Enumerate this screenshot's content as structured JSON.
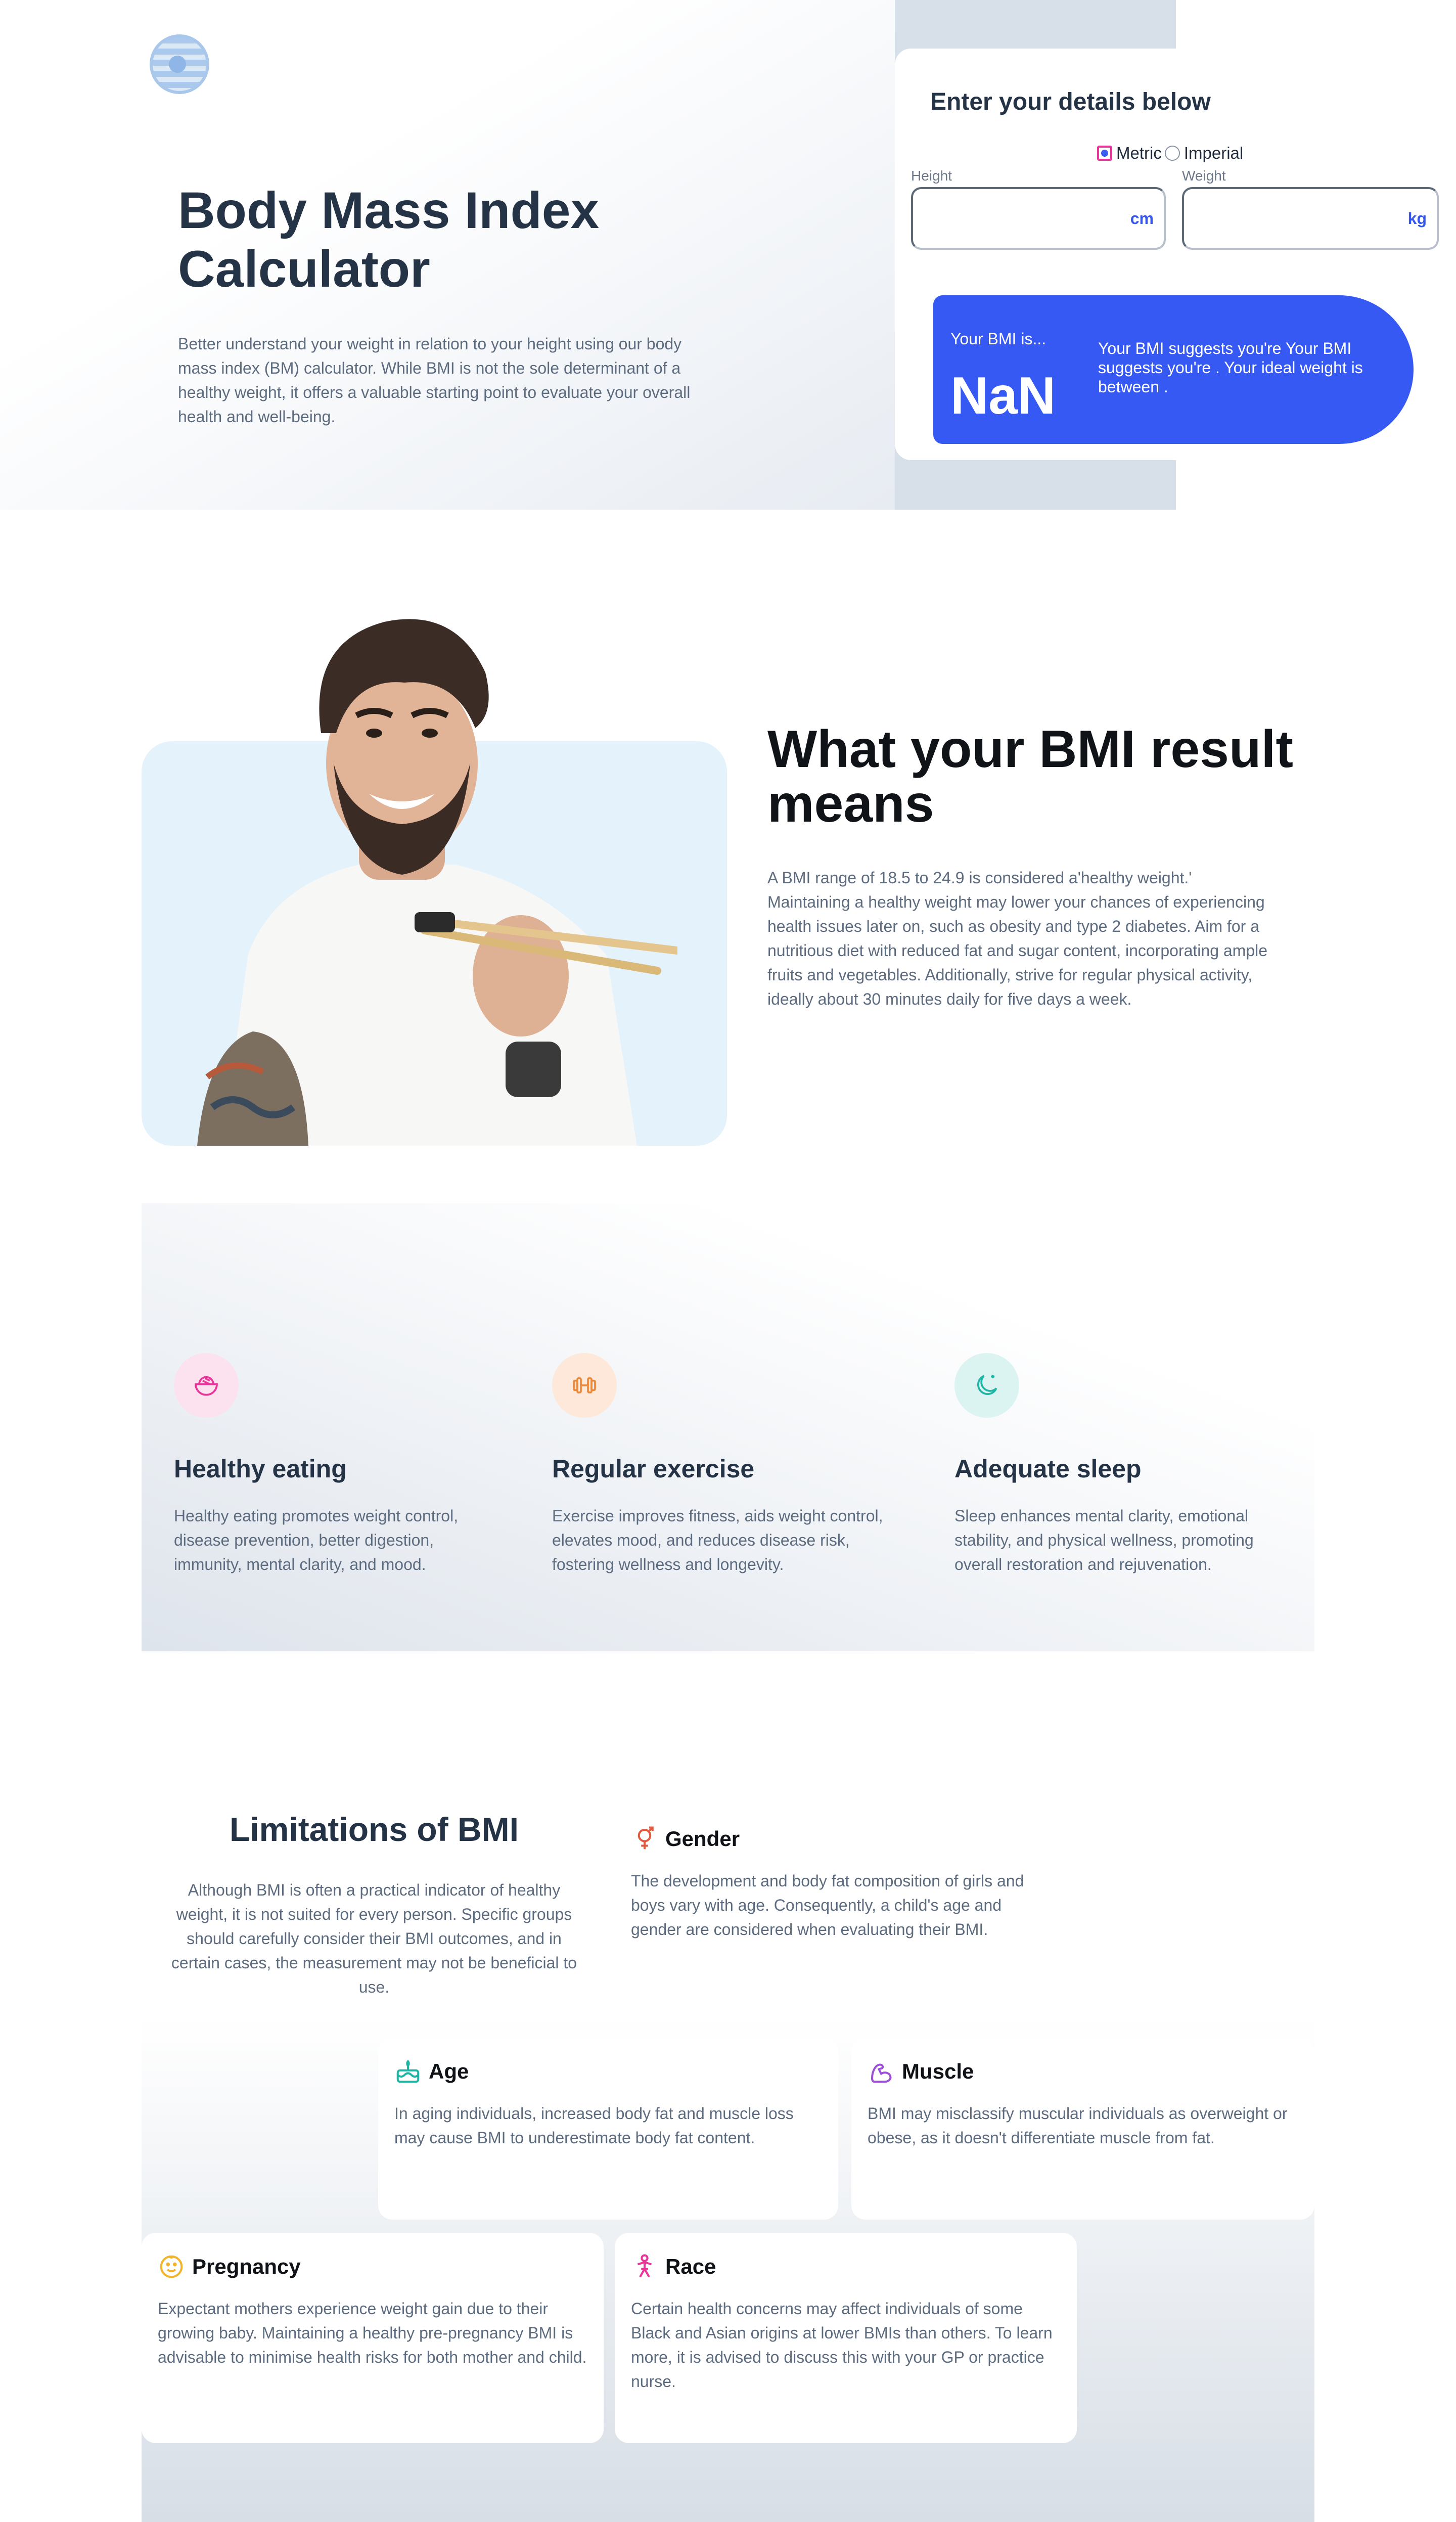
{
  "hero": {
    "title": "Body Mass Index Calculator",
    "description": "Better understand your weight in relation to your height using our body mass index (BM) calculator. While BMI is not the sole determinant of a healthy weight, it offers a valuable starting point to evaluate your overall health and well-being."
  },
  "calculator": {
    "title": "Enter your details below",
    "unit_options": [
      "Metric",
      "Imperial"
    ],
    "selected_unit": "Metric",
    "height_label": "Height",
    "height_value": "",
    "height_unit": "cm",
    "weight_label": "Weight",
    "weight_value": "",
    "weight_unit": "kg",
    "result_label": "Your BMI is...",
    "result_value": "NaN",
    "result_text": "Your BMI suggests you're Your BMI suggests you're . Your ideal weight is between ."
  },
  "meaning": {
    "title": "What your BMI result means",
    "description": "A BMI range of 18.5 to 24.9 is considered a'healthy weight.' Maintaining a healthy weight may lower your chances of experiencing health issues later on, such as obesity and type 2 diabetes. Aim for a nutritious diet with reduced fat and sugar content, incorporating ample fruits and vegetables. Additionally, strive for regular physical activity, ideally about 30 minutes daily for five days a week."
  },
  "features": [
    {
      "icon": "food-bowl-icon",
      "title": "Healthy eating",
      "description": "Healthy eating promotes weight control, disease prevention, better digestion, immunity, mental clarity, and mood.",
      "color": "#e7359a",
      "bg": "#fce2ee"
    },
    {
      "icon": "dumbbell-icon",
      "title": "Regular exercise",
      "description": "Exercise improves fitness, aids weight control, elevates mood, and reduces disease risk, fostering wellness and longevity.",
      "color": "#ec8a3b",
      "bg": "#fde8d9"
    },
    {
      "icon": "moon-icon",
      "title": "Adequate sleep",
      "description": "Sleep enhances mental clarity, emotional stability, and physical wellness, promoting overall restoration and rejuvenation.",
      "color": "#1fb5a5",
      "bg": "#dcf4f1"
    }
  ],
  "limitations": {
    "title": "Limitations of BMI",
    "description": "Although BMI is often a practical indicator of healthy weight, it is not suited for every person. Specific groups should carefully consider their BMI outcomes, and in certain cases, the measurement may not be beneficial to use.",
    "items": [
      {
        "icon": "gender-icon",
        "title": "Gender",
        "description": "The development and body fat composition of girls and boys vary with age. Consequently, a child's age and gender are considered when evaluating their BMI.",
        "color": "#e25a3e"
      },
      {
        "icon": "birthday-cake-icon",
        "title": "Age",
        "description": "In aging individuals, increased body fat and muscle loss may cause BMI to underestimate body fat content.",
        "color": "#1fb5a5"
      },
      {
        "icon": "muscle-arm-icon",
        "title": "Muscle",
        "description": "BMI may misclassify muscular individuals as overweight or obese, as it doesn't differentiate muscle from fat.",
        "color": "#9a4fd6"
      },
      {
        "icon": "pregnancy-face-icon",
        "title": "Pregnancy",
        "description": "Expectant mothers experience weight gain due to their growing baby. Maintaining a healthy pre-pregnancy BMI is advisable to minimise health risks for both mother and child.",
        "color": "#f2b52a"
      },
      {
        "icon": "race-person-icon",
        "title": "Race",
        "description": "Certain health concerns may affect individuals of some Black and Asian origins at lower BMIs than others. To learn more, it is advised to discuss this with your GP or practice nurse.",
        "color": "#e7359a"
      }
    ]
  }
}
